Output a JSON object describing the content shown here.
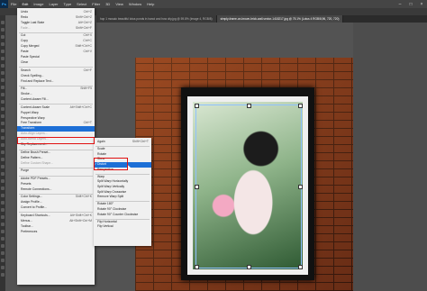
{
  "menubar": {
    "app_icon": "Ps",
    "items": [
      "File",
      "Edit",
      "Image",
      "Layer",
      "Type",
      "Select",
      "Filter",
      "3D",
      "View",
      "Window",
      "Help"
    ],
    "window_buttons": [
      "–",
      "□",
      "×"
    ]
  },
  "tabs": [
    "hop 1 mosaic beautiful lotus ponds in hanoi and how city.jpg @ 59.8% (Image 4, RGB/8)",
    "simply-frame-on-brown-brick-wall-vector-1418217.jpg @ 75.1% (Lotus 4 RGB/8,96, 720, 720)"
  ],
  "edit_menu": {
    "items": [
      {
        "label": "Undo",
        "shortcut": "Ctrl+Z",
        "disabled": false
      },
      {
        "label": "Redo",
        "shortcut": "Shift+Ctrl+Z",
        "disabled": false
      },
      {
        "label": "Toggle Last State",
        "shortcut": "Alt+Ctrl+Z",
        "disabled": false
      },
      {
        "label": "Fade...",
        "shortcut": "Shift+Ctrl+F",
        "disabled": true
      },
      {
        "sep": true
      },
      {
        "label": "Cut",
        "shortcut": "Ctrl+X",
        "disabled": false
      },
      {
        "label": "Copy",
        "shortcut": "Ctrl+C",
        "disabled": false
      },
      {
        "label": "Copy Merged",
        "shortcut": "Shift+Ctrl+C",
        "disabled": false
      },
      {
        "label": "Paste",
        "shortcut": "Ctrl+V",
        "disabled": false
      },
      {
        "label": "Paste Special",
        "shortcut": "",
        "disabled": false
      },
      {
        "label": "Clear",
        "shortcut": "",
        "disabled": false
      },
      {
        "sep": true
      },
      {
        "label": "Search",
        "shortcut": "Ctrl+F",
        "disabled": false
      },
      {
        "label": "Check Spelling...",
        "shortcut": "",
        "disabled": false
      },
      {
        "label": "Find and Replace Text...",
        "shortcut": "",
        "disabled": false
      },
      {
        "sep": true
      },
      {
        "label": "Fill...",
        "shortcut": "Shift+F5",
        "disabled": false
      },
      {
        "label": "Stroke...",
        "shortcut": "",
        "disabled": false
      },
      {
        "label": "Content-Aware Fill...",
        "shortcut": "",
        "disabled": false
      },
      {
        "sep": true
      },
      {
        "label": "Content-Aware Scale",
        "shortcut": "Alt+Shift+Ctrl+C",
        "disabled": false
      },
      {
        "label": "Puppet Warp",
        "shortcut": "",
        "disabled": false
      },
      {
        "label": "Perspective Warp",
        "shortcut": "",
        "disabled": false
      },
      {
        "label": "Free Transform",
        "shortcut": "Ctrl+T",
        "disabled": false
      },
      {
        "label": "Transform",
        "shortcut": "",
        "disabled": false,
        "highlight": true
      },
      {
        "label": "Auto-Align Layers...",
        "shortcut": "",
        "disabled": true
      },
      {
        "label": "Auto-Blend Layers...",
        "shortcut": "",
        "disabled": true
      },
      {
        "label": "Sky Replacement...",
        "shortcut": "",
        "disabled": false
      },
      {
        "sep": true
      },
      {
        "label": "Define Brush Preset...",
        "shortcut": "",
        "disabled": false
      },
      {
        "label": "Define Pattern...",
        "shortcut": "",
        "disabled": false
      },
      {
        "label": "Define Custom Shape...",
        "shortcut": "",
        "disabled": true
      },
      {
        "sep": true
      },
      {
        "label": "Purge",
        "shortcut": "",
        "disabled": false
      },
      {
        "sep": true
      },
      {
        "label": "Adobe PDF Presets...",
        "shortcut": "",
        "disabled": false
      },
      {
        "label": "Presets",
        "shortcut": "",
        "disabled": false
      },
      {
        "label": "Remote Connections...",
        "shortcut": "",
        "disabled": false
      },
      {
        "sep": true
      },
      {
        "label": "Color Settings...",
        "shortcut": "Shift+Ctrl+K",
        "disabled": false
      },
      {
        "label": "Assign Profile...",
        "shortcut": "",
        "disabled": false
      },
      {
        "label": "Convert to Profile...",
        "shortcut": "",
        "disabled": false
      },
      {
        "sep": true
      },
      {
        "label": "Keyboard Shortcuts...",
        "shortcut": "Alt+Shift+Ctrl+K",
        "disabled": false
      },
      {
        "label": "Menus...",
        "shortcut": "Alt+Shift+Ctrl+M",
        "disabled": false
      },
      {
        "label": "Toolbar...",
        "shortcut": "",
        "disabled": false
      },
      {
        "label": "Preferences",
        "shortcut": "",
        "disabled": false
      }
    ]
  },
  "transform_submenu": {
    "items": [
      {
        "label": "Again",
        "shortcut": "Shift+Ctrl+T"
      },
      {
        "sep": true
      },
      {
        "label": "Scale",
        "shortcut": ""
      },
      {
        "label": "Rotate",
        "shortcut": ""
      },
      {
        "label": "Skew",
        "shortcut": "",
        "boxed": true
      },
      {
        "label": "Distort",
        "shortcut": "",
        "highlight": true,
        "checked": true
      },
      {
        "label": "Perspective",
        "shortcut": ""
      },
      {
        "sep": true
      },
      {
        "label": "Warp",
        "shortcut": ""
      },
      {
        "label": "Split Warp Horizontally",
        "shortcut": ""
      },
      {
        "label": "Split Warp Vertically",
        "shortcut": ""
      },
      {
        "label": "Split Warp Crosswise",
        "shortcut": ""
      },
      {
        "label": "Remove Warp Split",
        "shortcut": ""
      },
      {
        "sep": true
      },
      {
        "label": "Rotate 180°",
        "shortcut": ""
      },
      {
        "label": "Rotate 90° Clockwise",
        "shortcut": ""
      },
      {
        "label": "Rotate 90° Counter Clockwise",
        "shortcut": ""
      },
      {
        "sep": true
      },
      {
        "label": "Flip Horizontal",
        "shortcut": ""
      },
      {
        "label": "Flip Vertical",
        "shortcut": ""
      }
    ]
  },
  "colors": {
    "highlight": "#1d6fd6",
    "annotation": "#e01010",
    "brick": "#7a3419"
  }
}
